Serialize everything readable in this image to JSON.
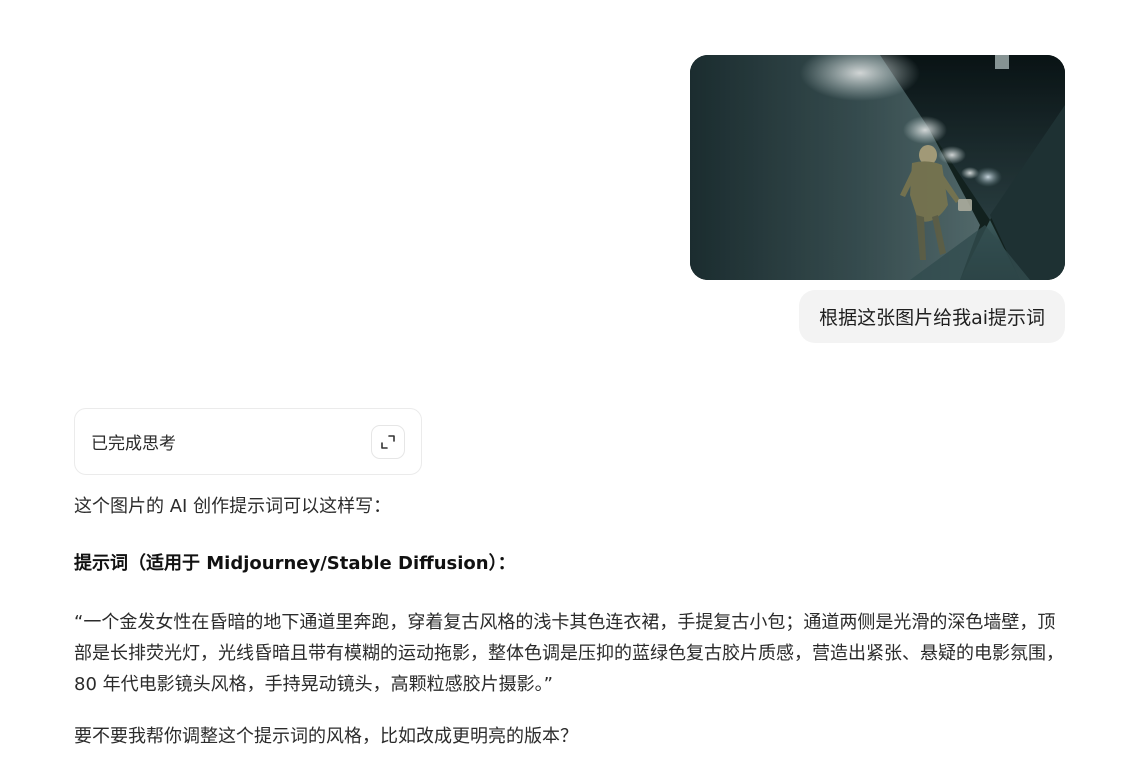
{
  "user_message": {
    "image_alt": "blurry photo of a blonde woman running down a dim tunnel corridor",
    "text": "根据这张图片给我ai提示词"
  },
  "thinking": {
    "label": "已完成思考",
    "expand_icon": "expand-icon"
  },
  "answer": {
    "intro": "这个图片的 AI 创作提示词可以这样写：",
    "heading": "提示词（适用于 Midjourney/Stable Diffusion）：",
    "prompt": "“一个金发女性在昏暗的地下通道里奔跑，穿着复古风格的浅卡其色连衣裙，手提复古小包；通道两侧是光滑的深色墙壁，顶部是长排荧光灯，光线昏暗且带有模糊的运动拖影，整体色调是压抑的蓝绿色复古胶片质感，营造出紧张、悬疑的电影氛围，80 年代电影镜头风格，手持晃动镜头，高颗粒感胶片摄影。”",
    "closing": "要不要我帮你调整这个提示词的风格，比如改成更明亮的版本？"
  },
  "colors": {
    "bubble_bg": "#f3f3f3",
    "tunnel_dark": "#0e1c1f",
    "tunnel_teal": "#4f6a6e"
  }
}
